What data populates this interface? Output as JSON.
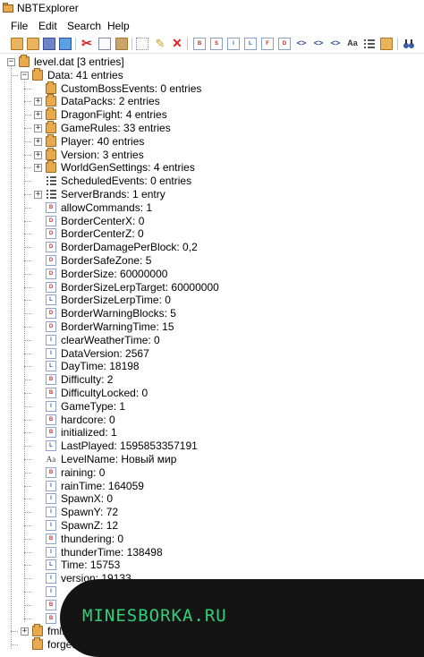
{
  "window": {
    "title": "NBTExplorer"
  },
  "menu": [
    "File",
    "Edit",
    "Search",
    "Help"
  ],
  "toolbar": [
    "open-folder-icon",
    "open-file-icon",
    "save-icon",
    "refresh-icon",
    "cut-icon",
    "copy-icon",
    "paste-icon",
    "rename-icon",
    "edit-icon",
    "delete-icon",
    "tag-byte-icon",
    "tag-short-icon",
    "tag-int-icon",
    "tag-long-icon",
    "tag-float-icon",
    "tag-double-icon",
    "tag-byte-array-icon",
    "tag-int-array-icon",
    "tag-long-array-icon",
    "tag-string-icon",
    "tag-list-icon",
    "tag-compound-icon",
    "find-icon"
  ],
  "tree": [
    {
      "label": "level.dat [3 entries]",
      "icon": "file",
      "toggle": "-"
    },
    {
      "label": "Data: 41 entries",
      "icon": "folder",
      "toggle": "-"
    },
    {
      "label": "CustomBossEvents: 0 entries",
      "icon": "folder",
      "toggle": ""
    },
    {
      "label": "DataPacks: 2 entries",
      "icon": "folder",
      "toggle": "+"
    },
    {
      "label": "DragonFight: 4 entries",
      "icon": "folder",
      "toggle": "+"
    },
    {
      "label": "GameRules: 33 entries",
      "icon": "folder",
      "toggle": "+"
    },
    {
      "label": "Player: 40 entries",
      "icon": "folder",
      "toggle": "+"
    },
    {
      "label": "Version: 3 entries",
      "icon": "folder",
      "toggle": "+"
    },
    {
      "label": "WorldGenSettings: 4 entries",
      "icon": "folder",
      "toggle": "+"
    },
    {
      "label": "ScheduledEvents: 0 entries",
      "icon": "list",
      "toggle": ""
    },
    {
      "label": "ServerBrands: 1 entry",
      "icon": "list",
      "toggle": "+"
    },
    {
      "label": "allowCommands: 1",
      "icon": "tag",
      "tag": "B"
    },
    {
      "label": "BorderCenterX: 0",
      "icon": "tag",
      "tag": "D"
    },
    {
      "label": "BorderCenterZ: 0",
      "icon": "tag",
      "tag": "D"
    },
    {
      "label": "BorderDamagePerBlock: 0,2",
      "icon": "tag",
      "tag": "D"
    },
    {
      "label": "BorderSafeZone: 5",
      "icon": "tag",
      "tag": "D"
    },
    {
      "label": "BorderSize: 60000000",
      "icon": "tag",
      "tag": "D"
    },
    {
      "label": "BorderSizeLerpTarget: 60000000",
      "icon": "tag",
      "tag": "D"
    },
    {
      "label": "BorderSizeLerpTime: 0",
      "icon": "tag",
      "tag": "L"
    },
    {
      "label": "BorderWarningBlocks: 5",
      "icon": "tag",
      "tag": "D"
    },
    {
      "label": "BorderWarningTime: 15",
      "icon": "tag",
      "tag": "D"
    },
    {
      "label": "clearWeatherTime: 0",
      "icon": "tag",
      "tag": "I"
    },
    {
      "label": "DataVersion: 2567",
      "icon": "tag",
      "tag": "I"
    },
    {
      "label": "DayTime: 18198",
      "icon": "tag",
      "tag": "L"
    },
    {
      "label": "Difficulty: 2",
      "icon": "tag",
      "tag": "B"
    },
    {
      "label": "DifficultyLocked: 0",
      "icon": "tag",
      "tag": "B"
    },
    {
      "label": "GameType: 1",
      "icon": "tag",
      "tag": "I"
    },
    {
      "label": "hardcore: 0",
      "icon": "tag",
      "tag": "B"
    },
    {
      "label": "initialized: 1",
      "icon": "tag",
      "tag": "B"
    },
    {
      "label": "LastPlayed: 1595853357191",
      "icon": "tag",
      "tag": "L"
    },
    {
      "label": "LevelName: Новый мир",
      "icon": "string",
      "tag": "Aa"
    },
    {
      "label": "raining: 0",
      "icon": "tag",
      "tag": "B"
    },
    {
      "label": "rainTime: 164059",
      "icon": "tag",
      "tag": "I"
    },
    {
      "label": "SpawnX: 0",
      "icon": "tag",
      "tag": "I"
    },
    {
      "label": "SpawnY: 72",
      "icon": "tag",
      "tag": "I"
    },
    {
      "label": "SpawnZ: 12",
      "icon": "tag",
      "tag": "I"
    },
    {
      "label": "thundering: 0",
      "icon": "tag",
      "tag": "B"
    },
    {
      "label": "thunderTime: 138498",
      "icon": "tag",
      "tag": "I"
    },
    {
      "label": "Time: 15753",
      "icon": "tag",
      "tag": "L"
    },
    {
      "label": "version: 19133",
      "icon": "tag",
      "tag": "I"
    },
    {
      "label": "",
      "icon": "tag",
      "tag": "I"
    },
    {
      "label": "",
      "icon": "tag",
      "tag": "B"
    },
    {
      "label": "",
      "icon": "tag",
      "tag": "B"
    },
    {
      "label": "fml:",
      "icon": "folder",
      "toggle": "+"
    },
    {
      "label": "forge: 0",
      "icon": "folder",
      "toggle": ""
    }
  ],
  "watermark": "MINESBORKA.RU"
}
